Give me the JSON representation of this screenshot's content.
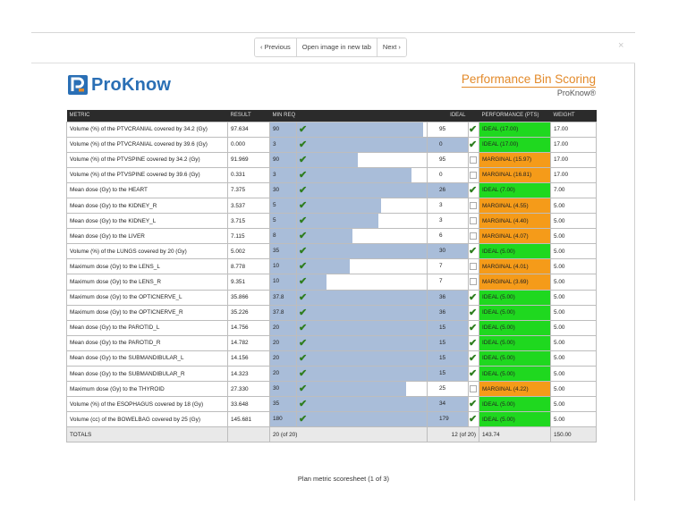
{
  "toolbar": {
    "previous_label": "‹ Previous",
    "open_label": "Open image in new tab",
    "next_label": "Next ›",
    "close_glyph": "×"
  },
  "logo": {
    "text": "ProKnow"
  },
  "report": {
    "title": "Performance Bin Scoring",
    "subtitle": "ProKnow®"
  },
  "colors": {
    "ideal": "#1fd81f",
    "marginal": "#f59b19",
    "bar": "#a9bdd9",
    "logo": "#2a6fb5",
    "accent": "#e38a2a"
  },
  "columns": [
    "METRIC",
    "RESULT",
    "MIN REQ",
    "IDEAL",
    "PERFORMANCE (PTS)",
    "WEIGHT"
  ],
  "rows": [
    {
      "metric": "Volume (%) of the PTVCRANIAL covered by 34.2 (Gy)",
      "result": "97.634",
      "min": "90",
      "ideal": "95",
      "met": true,
      "status": "ideal",
      "perf": "IDEAL (17.00)",
      "weight": "17.00",
      "fill": 0.97
    },
    {
      "metric": "Volume (%) of the PTVCRANIAL covered by 39.6 (Gy)",
      "result": "0.000",
      "min": "3",
      "ideal": "0",
      "met": true,
      "status": "ideal",
      "perf": "IDEAL (17.00)",
      "weight": "17.00",
      "fill": 1.0
    },
    {
      "metric": "Volume (%) of the PTVSPINE covered by 34.2 (Gy)",
      "result": "91.969",
      "min": "90",
      "ideal": "95",
      "met": false,
      "status": "marginal",
      "perf": "MARGINAL (15.97)",
      "weight": "17.00",
      "fill": 0.47
    },
    {
      "metric": "Volume (%) of the PTVSPINE covered by 39.6 (Gy)",
      "result": "0.331",
      "min": "3",
      "ideal": "0",
      "met": false,
      "status": "marginal",
      "perf": "MARGINAL (16.81)",
      "weight": "17.00",
      "fill": 0.88
    },
    {
      "metric": "Mean dose (Gy) to the HEART",
      "result": "7.375",
      "min": "30",
      "ideal": "26",
      "met": true,
      "status": "ideal",
      "perf": "IDEAL (7.00)",
      "weight": "7.00",
      "fill": 1.0
    },
    {
      "metric": "Mean dose (Gy) to the KIDNEY_R",
      "result": "3.537",
      "min": "5",
      "ideal": "3",
      "met": false,
      "status": "marginal",
      "perf": "MARGINAL (4.55)",
      "weight": "5.00",
      "fill": 0.65
    },
    {
      "metric": "Mean dose (Gy) to the KIDNEY_L",
      "result": "3.715",
      "min": "5",
      "ideal": "3",
      "met": false,
      "status": "marginal",
      "perf": "MARGINAL (4.40)",
      "weight": "5.00",
      "fill": 0.63
    },
    {
      "metric": "Mean dose (Gy) to the LIVER",
      "result": "7.115",
      "min": "8",
      "ideal": "6",
      "met": false,
      "status": "marginal",
      "perf": "MARGINAL (4.07)",
      "weight": "5.00",
      "fill": 0.43
    },
    {
      "metric": "Volume (%) of the LUNGS covered by 20 (Gy)",
      "result": "5.002",
      "min": "35",
      "ideal": "30",
      "met": true,
      "status": "ideal",
      "perf": "IDEAL (5.00)",
      "weight": "5.00",
      "fill": 1.0
    },
    {
      "metric": "Maximum dose (Gy) to the LENS_L",
      "result": "8.778",
      "min": "10",
      "ideal": "7",
      "met": false,
      "status": "marginal",
      "perf": "MARGINAL (4.01)",
      "weight": "5.00",
      "fill": 0.41
    },
    {
      "metric": "Maximum dose (Gy) to the LENS_R",
      "result": "9.351",
      "min": "10",
      "ideal": "7",
      "met": false,
      "status": "marginal",
      "perf": "MARGINAL (3.69)",
      "weight": "5.00",
      "fill": 0.23
    },
    {
      "metric": "Maximum dose (Gy) to the OPTICNERVE_L",
      "result": "35.866",
      "min": "37.8",
      "ideal": "36",
      "met": true,
      "status": "ideal",
      "perf": "IDEAL (5.00)",
      "weight": "5.00",
      "fill": 1.0
    },
    {
      "metric": "Maximum dose (Gy) to the OPTICNERVE_R",
      "result": "35.226",
      "min": "37.8",
      "ideal": "36",
      "met": true,
      "status": "ideal",
      "perf": "IDEAL (5.00)",
      "weight": "5.00",
      "fill": 1.0
    },
    {
      "metric": "Mean dose (Gy) to the PAROTID_L",
      "result": "14.756",
      "min": "20",
      "ideal": "15",
      "met": true,
      "status": "ideal",
      "perf": "IDEAL (5.00)",
      "weight": "5.00",
      "fill": 1.0
    },
    {
      "metric": "Mean dose (Gy) to the PAROTID_R",
      "result": "14.782",
      "min": "20",
      "ideal": "15",
      "met": true,
      "status": "ideal",
      "perf": "IDEAL (5.00)",
      "weight": "5.00",
      "fill": 1.0
    },
    {
      "metric": "Mean dose (Gy) to the SUBMANDIBULAR_L",
      "result": "14.156",
      "min": "20",
      "ideal": "15",
      "met": true,
      "status": "ideal",
      "perf": "IDEAL (5.00)",
      "weight": "5.00",
      "fill": 1.0
    },
    {
      "metric": "Mean dose (Gy) to the SUBMANDIBULAR_R",
      "result": "14.323",
      "min": "20",
      "ideal": "15",
      "met": true,
      "status": "ideal",
      "perf": "IDEAL (5.00)",
      "weight": "5.00",
      "fill": 1.0
    },
    {
      "metric": "Maximum dose (Gy) to the THYROID",
      "result": "27.330",
      "min": "30",
      "ideal": "25",
      "met": false,
      "status": "marginal",
      "perf": "MARGINAL (4.22)",
      "weight": "5.00",
      "fill": 0.84
    },
    {
      "metric": "Volume (%) of the ESOPHAGUS covered by 18 (Gy)",
      "result": "33.648",
      "min": "35",
      "ideal": "34",
      "met": true,
      "status": "ideal",
      "perf": "IDEAL (5.00)",
      "weight": "5.00",
      "fill": 1.0
    },
    {
      "metric": "Volume (cc) of the BOWELBAG covered by 25 (Gy)",
      "result": "145.681",
      "min": "180",
      "ideal": "179",
      "met": true,
      "status": "ideal",
      "perf": "IDEAL (5.00)",
      "weight": "5.00",
      "fill": 1.0
    }
  ],
  "totals": {
    "label": "TOTALS",
    "min_count": "20 (of 20)",
    "ideal_count": "12 (of 20)",
    "points": "143.74",
    "weight": "150.00"
  },
  "footer": {
    "caption": "Plan metric scoresheet (1 of 3)"
  }
}
